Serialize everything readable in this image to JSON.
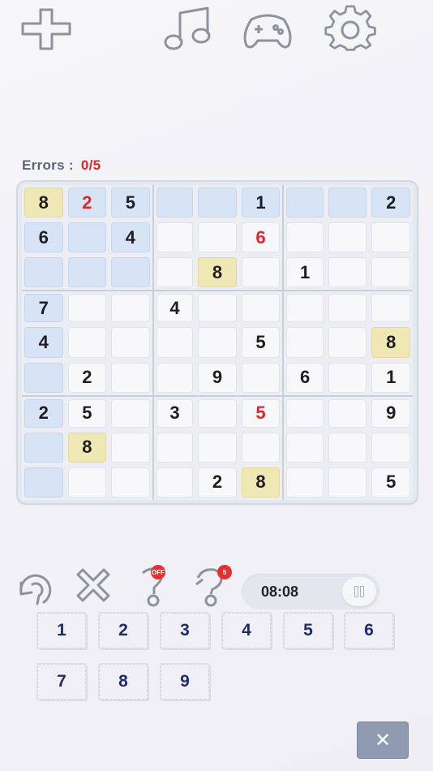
{
  "top_icons": [
    "plus-icon",
    "music-icon",
    "gamepad-icon",
    "gear-icon"
  ],
  "errors": {
    "label": "Errors :",
    "value": "0/5"
  },
  "grid": [
    [
      "8",
      "2",
      "5",
      "",
      "",
      "1",
      "",
      "",
      "2"
    ],
    [
      "6",
      "",
      "4",
      "",
      "",
      "6",
      "",
      "",
      ""
    ],
    [
      "",
      "",
      "",
      "",
      "8",
      "",
      "1",
      "",
      ""
    ],
    [
      "7",
      "",
      "",
      "4",
      "",
      "",
      "",
      "",
      ""
    ],
    [
      "4",
      "",
      "",
      "",
      "",
      "5",
      "",
      "",
      "8"
    ],
    [
      "",
      "2",
      "",
      "",
      "9",
      "",
      "6",
      "",
      "1"
    ],
    [
      "2",
      "5",
      "",
      "3",
      "",
      "5",
      "",
      "",
      "9"
    ],
    [
      "",
      "8",
      "",
      "",
      "",
      "",
      "",
      "",
      ""
    ],
    [
      "",
      "",
      "",
      "",
      "2",
      "8",
      "",
      "",
      "5"
    ]
  ],
  "highlighted_cells": [
    [
      0,
      1
    ],
    [
      0,
      2
    ],
    [
      0,
      3
    ],
    [
      0,
      4
    ],
    [
      0,
      5
    ],
    [
      0,
      6
    ],
    [
      0,
      7
    ],
    [
      0,
      8
    ],
    [
      1,
      0
    ],
    [
      1,
      1
    ],
    [
      1,
      2
    ],
    [
      2,
      0
    ],
    [
      2,
      1
    ],
    [
      2,
      2
    ],
    [
      3,
      0
    ],
    [
      4,
      0
    ],
    [
      5,
      0
    ],
    [
      6,
      0
    ],
    [
      7,
      0
    ],
    [
      8,
      0
    ]
  ],
  "selected_cells": [
    [
      0,
      0
    ],
    [
      2,
      4
    ],
    [
      4,
      8
    ],
    [
      7,
      1
    ],
    [
      8,
      5
    ]
  ],
  "error_cells": [
    [
      0,
      1
    ],
    [
      1,
      5
    ],
    [
      6,
      5
    ]
  ],
  "tools": {
    "undo": "undo-icon",
    "erase": "erase-icon",
    "notes": {
      "icon": "pencil-icon",
      "badge": "OFF"
    },
    "hint": {
      "icon": "hint-icon",
      "badge": "5"
    }
  },
  "timer": {
    "time": "08:08"
  },
  "number_pad": [
    "1",
    "2",
    "3",
    "4",
    "5",
    "6",
    "7",
    "8",
    "9"
  ],
  "close_label": "✕",
  "colors": {
    "error": "#e0262b",
    "highlight": "#d6e4f6",
    "selected": "#efe8b5",
    "number": "#1d2d6b"
  }
}
